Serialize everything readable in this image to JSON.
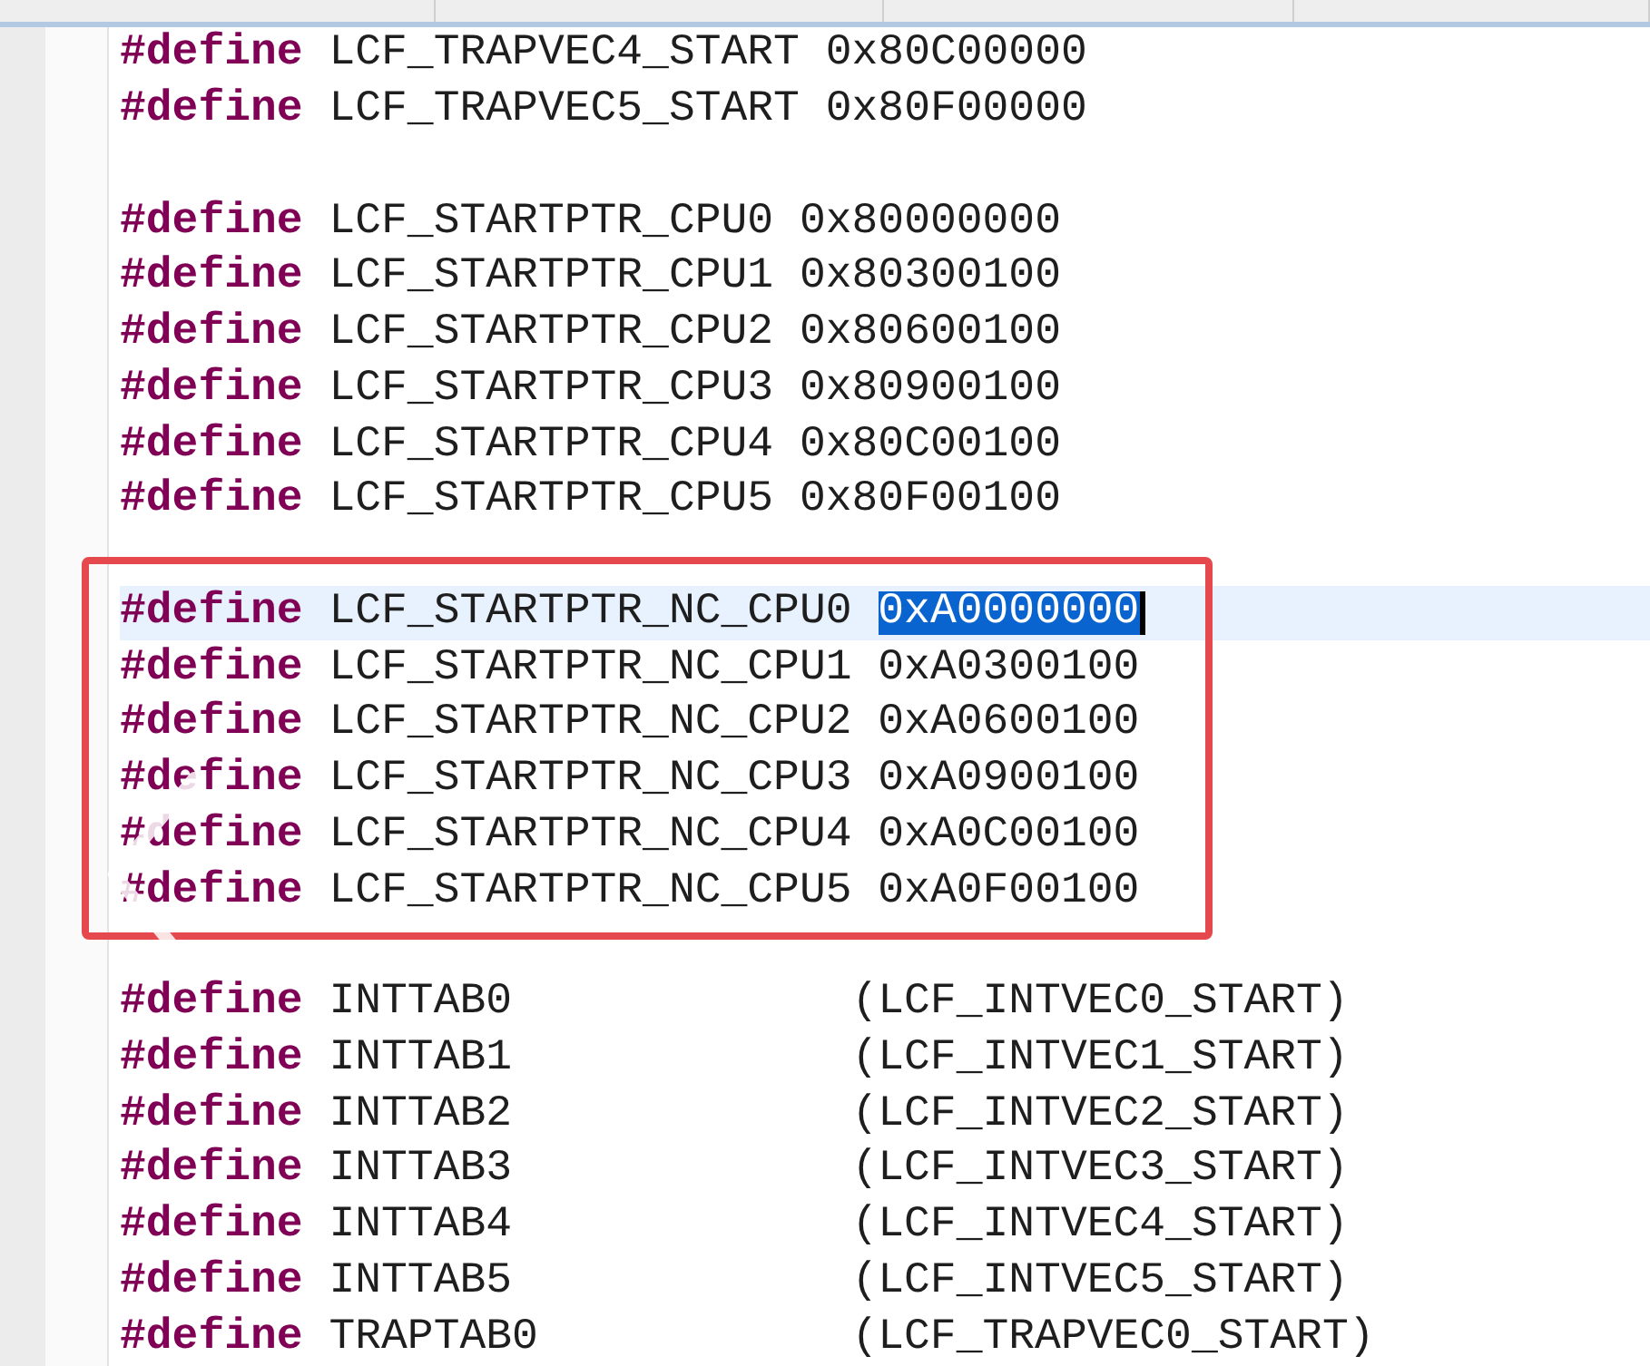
{
  "tabs": [
    {
      "selected": false
    },
    {
      "selected": false
    },
    {
      "selected": false
    },
    {
      "selected": false
    }
  ],
  "blocks": [
    {
      "boxed": false,
      "lines": [
        {
          "kind": "define",
          "keyword": "#define",
          "name": "LCF_TRAPVEC4_START",
          "value": "0x80C00000",
          "current": false,
          "value_selected": false
        },
        {
          "kind": "define",
          "keyword": "#define",
          "name": "LCF_TRAPVEC5_START",
          "value": "0x80F00000",
          "current": false,
          "value_selected": false
        }
      ]
    },
    {
      "boxed": false,
      "lines": [
        {
          "kind": "define",
          "keyword": "#define",
          "name": "LCF_STARTPTR_CPU0",
          "value": "0x80000000",
          "current": false,
          "value_selected": false
        },
        {
          "kind": "define",
          "keyword": "#define",
          "name": "LCF_STARTPTR_CPU1",
          "value": "0x80300100",
          "current": false,
          "value_selected": false
        },
        {
          "kind": "define",
          "keyword": "#define",
          "name": "LCF_STARTPTR_CPU2",
          "value": "0x80600100",
          "current": false,
          "value_selected": false
        },
        {
          "kind": "define",
          "keyword": "#define",
          "name": "LCF_STARTPTR_CPU3",
          "value": "0x80900100",
          "current": false,
          "value_selected": false
        },
        {
          "kind": "define",
          "keyword": "#define",
          "name": "LCF_STARTPTR_CPU4",
          "value": "0x80C00100",
          "current": false,
          "value_selected": false
        },
        {
          "kind": "define",
          "keyword": "#define",
          "name": "LCF_STARTPTR_CPU5",
          "value": "0x80F00100",
          "current": false,
          "value_selected": false
        }
      ]
    },
    {
      "boxed": true,
      "lines": [
        {
          "kind": "define",
          "keyword": "#define",
          "name": "LCF_STARTPTR_NC_CPU0",
          "value": "0xA0000000",
          "current": true,
          "value_selected": true
        },
        {
          "kind": "define",
          "keyword": "#define",
          "name": "LCF_STARTPTR_NC_CPU1",
          "value": "0xA0300100",
          "current": false,
          "value_selected": false
        },
        {
          "kind": "define",
          "keyword": "#define",
          "name": "LCF_STARTPTR_NC_CPU2",
          "value": "0xA0600100",
          "current": false,
          "value_selected": false
        },
        {
          "kind": "define",
          "keyword": "#define",
          "name": "LCF_STARTPTR_NC_CPU3",
          "value": "0xA0900100",
          "current": false,
          "value_selected": false
        },
        {
          "kind": "define",
          "keyword": "#define",
          "name": "LCF_STARTPTR_NC_CPU4",
          "value": "0xA0C00100",
          "current": false,
          "value_selected": false
        },
        {
          "kind": "define",
          "keyword": "#define",
          "name": "LCF_STARTPTR_NC_CPU5",
          "value": "0xA0F00100",
          "current": false,
          "value_selected": false
        }
      ]
    },
    {
      "boxed": false,
      "lines": [
        {
          "kind": "aligned",
          "keyword": "#define",
          "name": "INTTAB0",
          "value": "(LCF_INTVEC0_START)",
          "current": false,
          "value_selected": false
        },
        {
          "kind": "aligned",
          "keyword": "#define",
          "name": "INTTAB1",
          "value": "(LCF_INTVEC1_START)",
          "current": false,
          "value_selected": false
        },
        {
          "kind": "aligned",
          "keyword": "#define",
          "name": "INTTAB2",
          "value": "(LCF_INTVEC2_START)",
          "current": false,
          "value_selected": false
        },
        {
          "kind": "aligned",
          "keyword": "#define",
          "name": "INTTAB3",
          "value": "(LCF_INTVEC3_START)",
          "current": false,
          "value_selected": false
        },
        {
          "kind": "aligned",
          "keyword": "#define",
          "name": "INTTAB4",
          "value": "(LCF_INTVEC4_START)",
          "current": false,
          "value_selected": false
        },
        {
          "kind": "aligned",
          "keyword": "#define",
          "name": "INTTAB5",
          "value": "(LCF_INTVEC5_START)",
          "current": false,
          "value_selected": false
        },
        {
          "kind": "aligned",
          "keyword": "#define",
          "name": "TRAPTAB0",
          "value": "(LCF_TRAPVEC0_START)",
          "current": false,
          "value_selected": false
        }
      ]
    }
  ]
}
